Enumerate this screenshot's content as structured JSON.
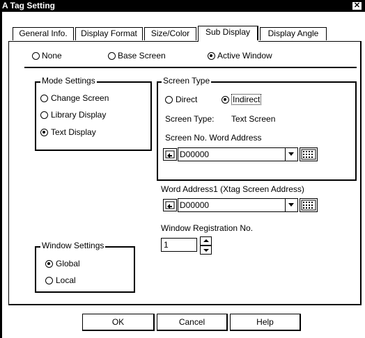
{
  "window": {
    "title": "A Tag Setting",
    "close_glyph": "✕"
  },
  "tabs": [
    {
      "label": "General Info."
    },
    {
      "label": "Display Format"
    },
    {
      "label": "Size/Color"
    },
    {
      "label": "Sub Display",
      "active": true
    },
    {
      "label": "Display Angle"
    }
  ],
  "sub_display": {
    "options": [
      {
        "label": "None",
        "selected": false
      },
      {
        "label": "Base Screen",
        "selected": false
      },
      {
        "label": "Active Window",
        "selected": true
      }
    ]
  },
  "mode_settings": {
    "title": "Mode Settings",
    "options": [
      {
        "label": "Change Screen",
        "selected": false
      },
      {
        "label": "Library Display",
        "selected": false
      },
      {
        "label": "Text Display",
        "selected": true
      }
    ]
  },
  "screen_type": {
    "title": "Screen Type",
    "options": [
      {
        "label": "Direct",
        "selected": false
      },
      {
        "label": "Indirect",
        "selected": true
      }
    ],
    "type_label": "Screen Type:",
    "type_value": "Text Screen",
    "word_address_label": "Screen No. Word Address",
    "word_address_value": "D00000"
  },
  "word_address1": {
    "label": "Word Address1 (Xtag Screen Address)",
    "value": "D00000"
  },
  "window_registration": {
    "label": "Window Registration No.",
    "value": "1"
  },
  "window_settings": {
    "title": "Window Settings",
    "options": [
      {
        "label": "Global",
        "selected": true
      },
      {
        "label": "Local",
        "selected": false
      }
    ]
  },
  "buttons": {
    "ok": "OK",
    "cancel": "Cancel",
    "help": "Help"
  }
}
